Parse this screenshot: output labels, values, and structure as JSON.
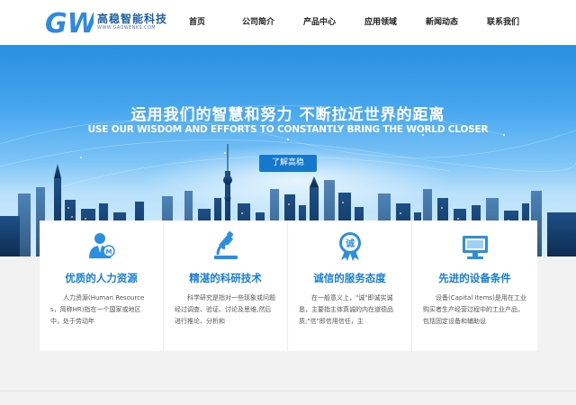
{
  "header": {
    "logo_mark": "GW",
    "logo_cn": "高稳智能科技",
    "logo_en": "WWW.GAOWENKS.COM",
    "nav": [
      "首页",
      "公司简介",
      "产品中心",
      "应用领域",
      "新闻动态",
      "联系我们"
    ]
  },
  "banner": {
    "title_cn": "运用我们的智慧和努力 不断拉近世界的距离",
    "title_en": "USE OUR WISDOM AND EFFORTS TO CONSTANTLY BRING THE WORLD CLOSER",
    "button": "了解高稳"
  },
  "cards": [
    {
      "icon": "person-medal-icon",
      "title": "优质的人力资源",
      "text": "人力资源(Human Resources，简称HR)指在一个国家或地区中，处于劳动年"
    },
    {
      "icon": "microscope-icon",
      "title": "精湛的科研技术",
      "text": "科学研究是指对一些现象或问题经过调查、验证、讨论及思维,然后进行推论、分析和"
    },
    {
      "icon": "integrity-badge-icon",
      "badge_char": "诚",
      "title": "诚信的服务态度",
      "text": "在一般意义上，\"诚\"即诚实诚恳，主要指主体真诚的内在道德品质;\"信\"即信用信任，主"
    },
    {
      "icon": "monitor-icon",
      "title": "先进的设备条件",
      "text": "设备(Capital Items)是用在工业购买者生产经营过程中的工业产品，包括固定设备和辅助设"
    }
  ],
  "colors": {
    "accent": "#1680d8",
    "button": "#1478cc",
    "logo": "#1a5fa8"
  }
}
